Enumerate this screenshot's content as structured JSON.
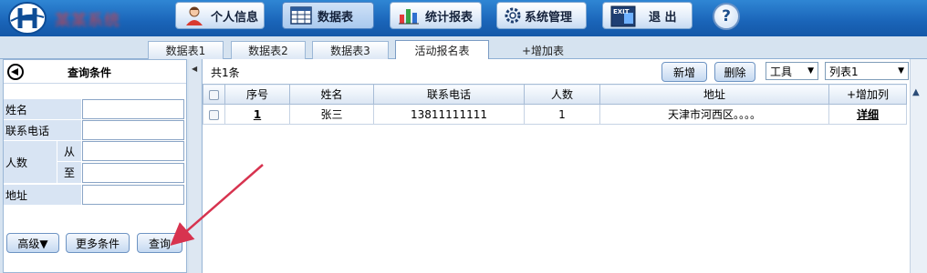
{
  "app": {
    "title": "某某系统"
  },
  "nav": [
    {
      "label": "个人信息",
      "icon": "person-icon"
    },
    {
      "label": "数据表",
      "icon": "table-icon",
      "active": true
    },
    {
      "label": "统计报表",
      "icon": "bar-chart-icon"
    },
    {
      "label": "系统管理",
      "icon": "gear-icon"
    },
    {
      "label": "退 出",
      "icon": "exit-icon",
      "badge": "EXIT"
    }
  ],
  "help": {
    "label": "?"
  },
  "tabs": [
    {
      "label": "数据表1"
    },
    {
      "label": "数据表2"
    },
    {
      "label": "数据表3"
    },
    {
      "label": "活动报名表",
      "active": true
    },
    {
      "label": "+增加表"
    }
  ],
  "query": {
    "title": "查询条件",
    "fields": {
      "name": {
        "label": "姓名",
        "value": ""
      },
      "phone": {
        "label": "联系电话",
        "value": ""
      },
      "count": {
        "label": "人数",
        "from_label": "从",
        "to_label": "至",
        "from_value": "",
        "to_value": ""
      },
      "address": {
        "label": "地址",
        "value": ""
      }
    },
    "buttons": {
      "advanced": "高级▼",
      "more": "更多条件",
      "search": "查询"
    }
  },
  "toolbar": {
    "total": "共1条",
    "add": "新增",
    "delete": "删除",
    "tools": "工具",
    "view": "列表1"
  },
  "grid": {
    "headers": [
      "序号",
      "姓名",
      "联系电话",
      "人数",
      "地址",
      "+增加列"
    ],
    "rows": [
      {
        "index": "1",
        "name": "张三",
        "phone": "13811111111",
        "count": "1",
        "address": "天津市河西区。。。。",
        "action": "详细"
      }
    ]
  },
  "colors": {
    "accent": "#1a64b8",
    "annotation_arrow": "#d7334f"
  }
}
